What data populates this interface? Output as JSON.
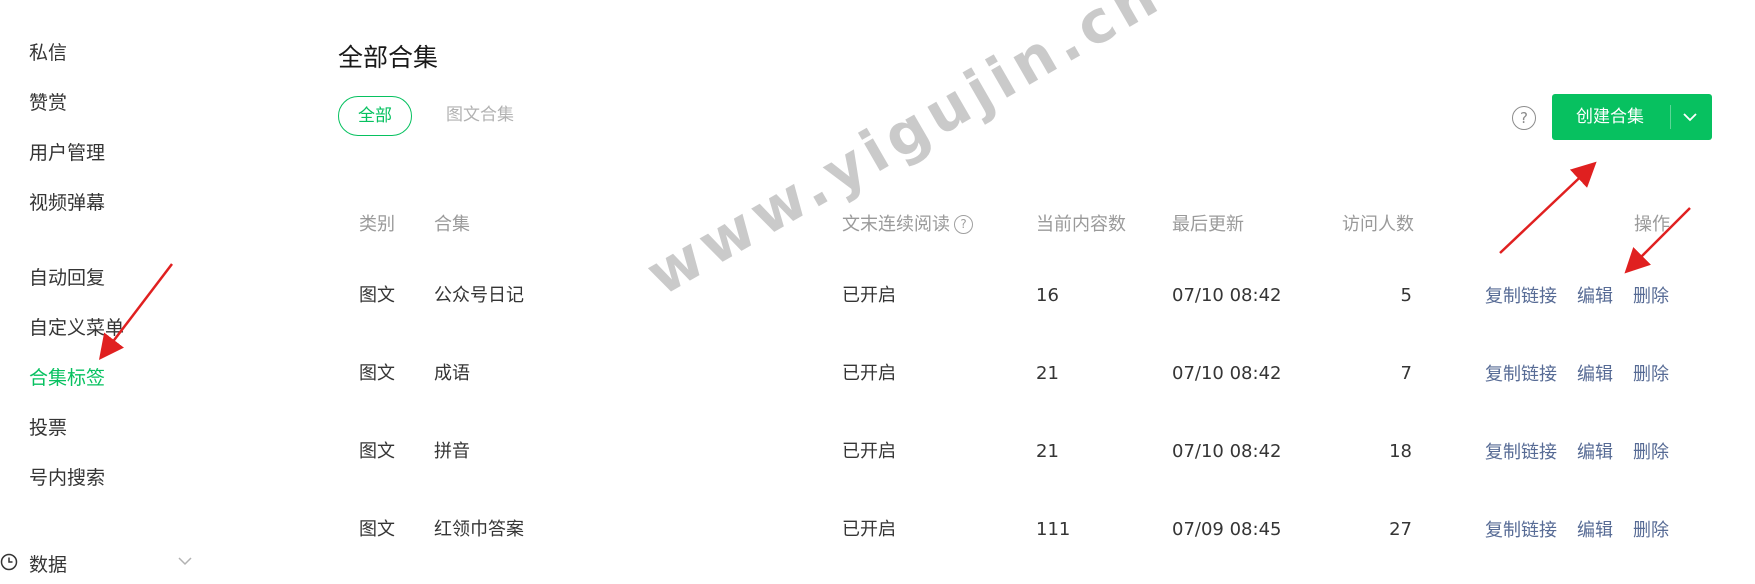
{
  "sidebar": {
    "items": [
      {
        "label": "私信"
      },
      {
        "label": "赞赏"
      },
      {
        "label": "用户管理"
      },
      {
        "label": "视频弹幕"
      },
      {
        "label": "自动回复"
      },
      {
        "label": "自定义菜单"
      },
      {
        "label": "合集标签"
      },
      {
        "label": "投票"
      },
      {
        "label": "号内搜索"
      }
    ],
    "active_label": "合集标签",
    "group": {
      "label": "数据",
      "icon": "clock-icon",
      "chevron": "chevron-down-icon"
    }
  },
  "main": {
    "title": "全部合集",
    "tabs": [
      {
        "label": "全部",
        "active": true
      },
      {
        "label": "图文合集",
        "active": false
      }
    ],
    "help_icon": "?",
    "create_button": {
      "label": "创建合集",
      "dropdown_icon": "chevron-down-icon"
    },
    "table": {
      "headers": {
        "category": "类别",
        "collection": "合集",
        "continuous_reading": "文末连续阅读",
        "content_count": "当前内容数",
        "last_updated": "最后更新",
        "visitors": "访问人数",
        "actions": "操作"
      },
      "header_help": "?",
      "rows": [
        {
          "category": "图文",
          "name": "公众号日记",
          "status": "已开启",
          "count": "16",
          "updated": "07/10 08:42",
          "visitors": "5"
        },
        {
          "category": "图文",
          "name": "成语",
          "status": "已开启",
          "count": "21",
          "updated": "07/10 08:42",
          "visitors": "7"
        },
        {
          "category": "图文",
          "name": "拼音",
          "status": "已开启",
          "count": "21",
          "updated": "07/10 08:42",
          "visitors": "18"
        },
        {
          "category": "图文",
          "name": "红领巾答案",
          "status": "已开启",
          "count": "111",
          "updated": "07/09 08:45",
          "visitors": "27"
        }
      ],
      "actions": {
        "copy_link": "复制链接",
        "edit": "编辑",
        "delete": "删除"
      }
    }
  },
  "watermark": "www.yigujin.cn",
  "colors": {
    "accent": "#07c160",
    "link": "#576b95",
    "annotation_arrow": "#e02020",
    "muted": "#9a9a9a"
  }
}
